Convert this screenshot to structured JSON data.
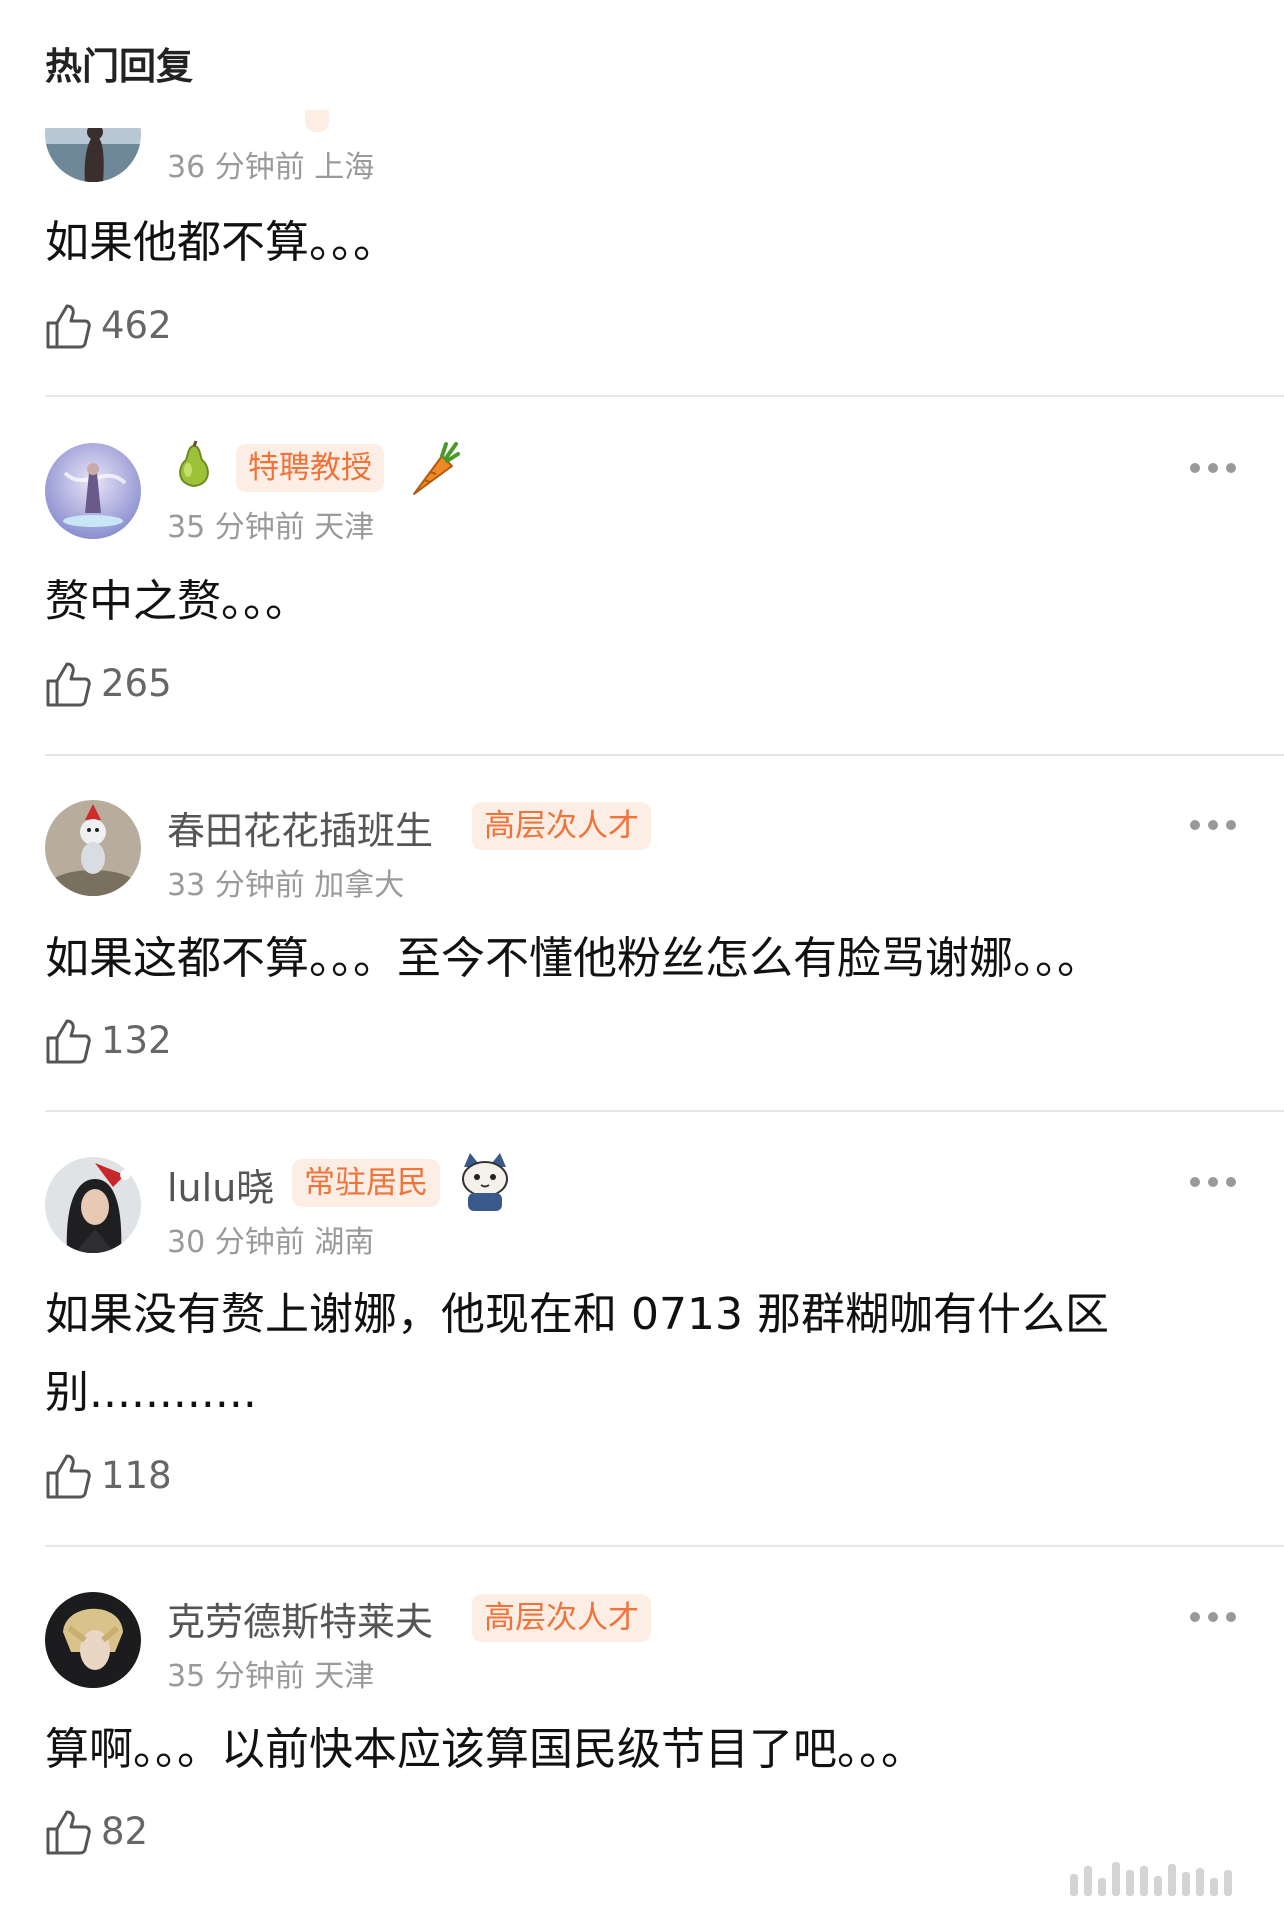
{
  "header": {
    "title": "热门回复"
  },
  "comments": [
    {
      "name": "",
      "badge": "",
      "meta": "36 分钟前 上海",
      "content": "如果他都不算。。。",
      "likes": "462"
    },
    {
      "name": "",
      "badge": "特聘教授",
      "meta": "35 分钟前 天津",
      "content": "赘中之赘。。。",
      "likes": "265",
      "stickers": [
        "pear-sticker",
        "carrot-sticker"
      ]
    },
    {
      "name": "春田花花插班生",
      "badge": "高层次人才",
      "meta": "33 分钟前 加拿大",
      "content": "如果这都不算。。。至今不懂他粉丝怎么有脸骂谢娜。。。",
      "likes": "132"
    },
    {
      "name": "lulu晓",
      "badge": "常驻居民",
      "meta": "30 分钟前 湖南",
      "content": "如果没有赘上谢娜，他现在和 0713 那群糊咖有什么区别............",
      "likes": "118",
      "stickers": [
        "cat-sticker"
      ]
    },
    {
      "name": "克劳德斯特莱夫",
      "badge": "高层次人才",
      "meta": "35 分钟前 天津",
      "content": "算啊。。。以前快本应该算国民级节目了吧。。。",
      "likes": "82"
    }
  ],
  "colors": {
    "badge_bg": "#fdeee5",
    "badge_text": "#f0733a",
    "meta": "#9a9a9a",
    "divider": "#e6e6e6"
  }
}
